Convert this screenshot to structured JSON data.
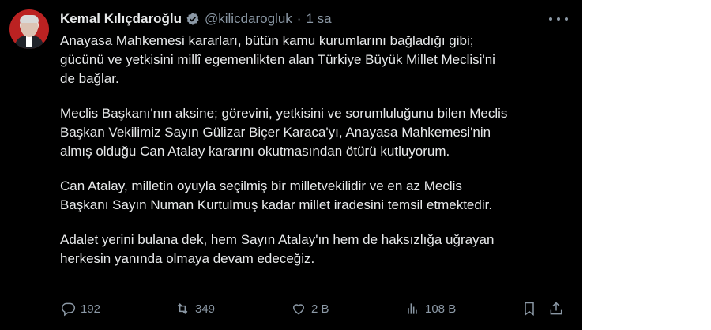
{
  "tweet": {
    "author_name": "Kemal Kılıçdaroğlu",
    "handle": "@kilicdarogluk",
    "separator": "·",
    "time": "1 sa",
    "paragraphs": [
      "Anayasa Mahkemesi kararları, bütün kamu kurumlarını bağladığı gibi;\ngücünü ve yetkisini millî egemenlikten alan Türkiye Büyük Millet Meclisi'ni\nde bağlar.",
      "Meclis Başkanı'nın aksine; görevini, yetkisini ve sorumluluğunu bilen Meclis\nBaşkan Vekilimiz Sayın Gülizar Biçer Karaca'yı, Anayasa Mahkemesi'nin\nalmış olduğu Can Atalay kararını okutmasından ötürü kutluyorum.",
      "Can Atalay, milletin oyuyla seçilmiş bir milletvekilidir ve en az Meclis\nBaşkanı Sayın Numan Kurtulmuş kadar millet iradesini temsil etmektedir.",
      "Adalet yerini bulana dek, hem Sayın Atalay'ın hem de haksızlığa uğrayan\nherkesin yanında olmaya devam edeceğiz."
    ],
    "actions": {
      "replies": "192",
      "retweets": "349",
      "likes": "2 B",
      "views": "108 B"
    }
  },
  "icons": {
    "verified": "verified-badge-icon",
    "more": "more-options-icon",
    "reply": "reply-icon",
    "retweet": "retweet-icon",
    "like": "heart-icon",
    "views": "views-chart-icon",
    "bookmark": "bookmark-icon",
    "share": "share-icon"
  },
  "colors": {
    "background": "#000000",
    "text": "#e7e9ea",
    "muted": "#8b98a5",
    "verified": "#8b98a5"
  }
}
